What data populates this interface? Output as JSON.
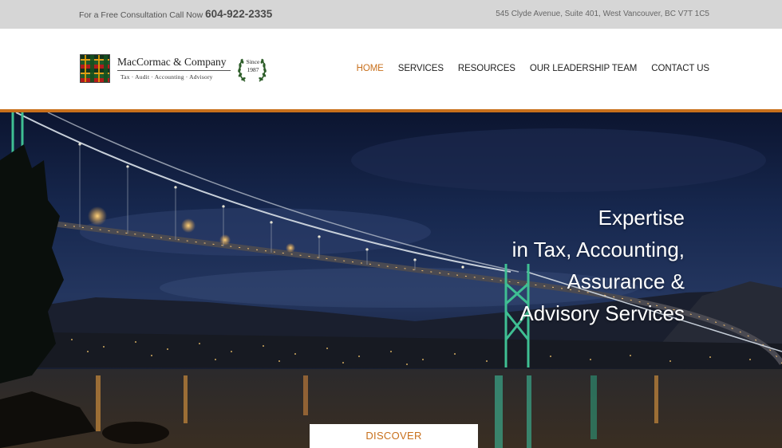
{
  "topbar": {
    "call_text": "For a Free Consultation Call Now",
    "phone": "604-922-2335",
    "address": "545 Clyde Avenue, Suite 401, West Vancouver, BC V7T 1C5"
  },
  "logo": {
    "name": "MacCormac & Company",
    "tagline": "Tax · Audit · Accounting · Advisory",
    "since_label": "Since",
    "since_year": "1987"
  },
  "nav": {
    "items": [
      {
        "label": "HOME",
        "active": true
      },
      {
        "label": "SERVICES",
        "active": false
      },
      {
        "label": "RESOURCES",
        "active": false
      },
      {
        "label": "OUR LEADERSHIP TEAM",
        "active": false
      },
      {
        "label": "CONTACT US",
        "active": false
      }
    ]
  },
  "hero": {
    "headline_lines": [
      "Expertise",
      "in Tax, Accounting,",
      "Assurance &",
      "Advisory Services"
    ],
    "cta_label": "DISCOVER"
  },
  "colors": {
    "accent": "#c8701c",
    "topbar_bg": "#d6d6d6",
    "text_dark": "#222222"
  }
}
